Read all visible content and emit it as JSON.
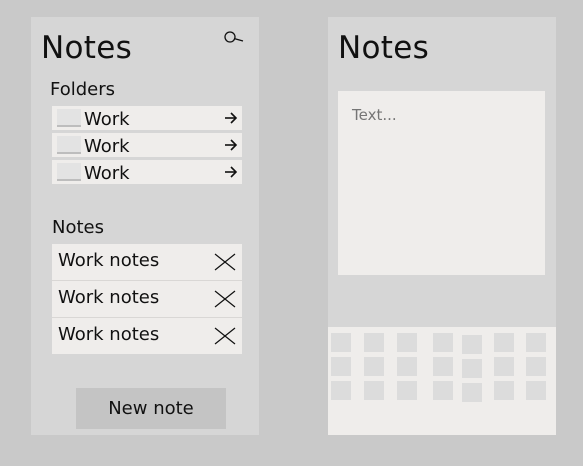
{
  "list_screen": {
    "title": "Notes",
    "search_icon": "magnifier-icon",
    "folders_heading": "Folders",
    "folders": [
      {
        "label": "Work",
        "icon": "arrow-right-icon"
      },
      {
        "label": "Work",
        "icon": "arrow-right-icon"
      },
      {
        "label": "Work",
        "icon": "arrow-right-icon"
      }
    ],
    "notes_heading": "Notes",
    "notes": [
      {
        "label": "Work notes",
        "icon": "close-icon"
      },
      {
        "label": "Work notes",
        "icon": "close-icon"
      },
      {
        "label": "Work notes",
        "icon": "close-icon"
      }
    ],
    "new_note_label": "New note"
  },
  "editor_screen": {
    "title": "Notes",
    "editor_placeholder": "Text..."
  },
  "colors": {
    "background": "#c9c9c9",
    "panel": "#d6d6d6",
    "item": "#efedeb",
    "button": "#c4c4c4",
    "key": "#dcdcdc"
  }
}
